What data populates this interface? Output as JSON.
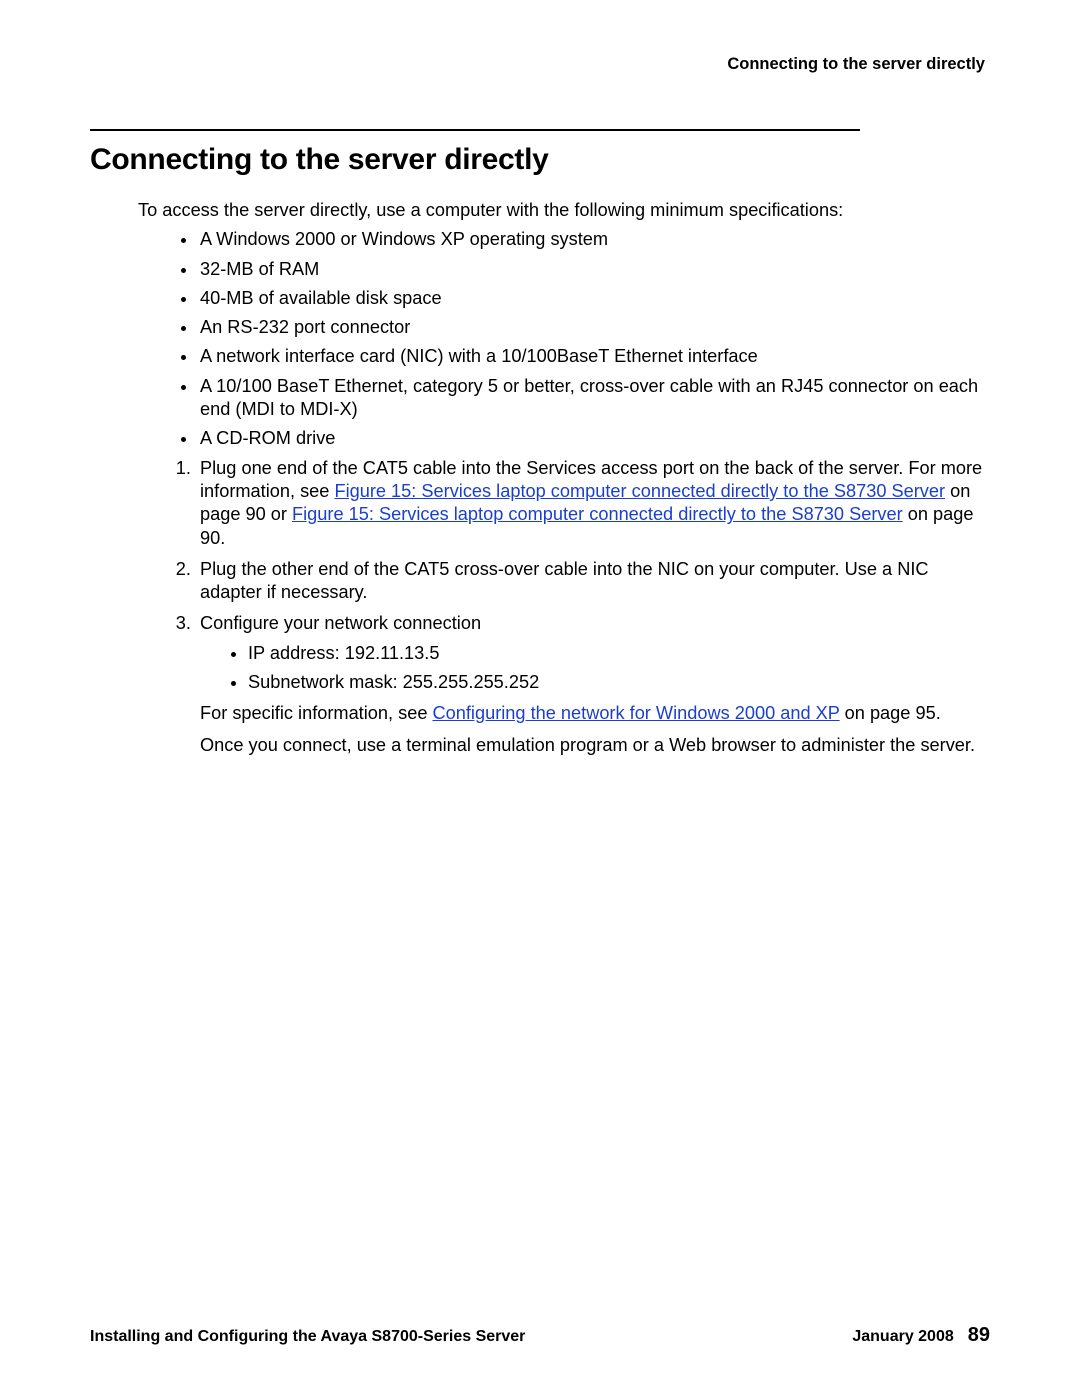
{
  "header": {
    "running_title": "Connecting to the server directly"
  },
  "title": "Connecting to the server directly",
  "intro": "To access the server directly, use a computer with the following minimum specifications:",
  "specs": [
    "A Windows 2000 or Windows XP operating system",
    "32-MB of RAM",
    "40-MB of available disk space",
    "An RS-232 port connector",
    "A network interface card (NIC) with a 10/100BaseT Ethernet interface",
    "A 10/100 BaseT Ethernet, category 5 or better, cross-over cable with an RJ45 connector on each end (MDI to MDI-X)",
    "A CD-ROM drive"
  ],
  "steps": {
    "s1": {
      "before_link1": "Plug one end of the CAT5 cable into the Services access port on the back of the server. For more information, see ",
      "link1": "Figure 15:  Services laptop computer connected directly to the S8730 Server",
      "between": " on page 90 or ",
      "link2": "Figure 15:  Services laptop computer connected directly to the S8730 Server",
      "after_link2": " on page 90."
    },
    "s2": "Plug the other end of the CAT5 cross-over cable into the NIC on your computer. Use a NIC adapter if necessary.",
    "s3": {
      "lead": "Configure your network connection",
      "items": [
        "IP address: 192.11.13.5",
        "Subnetwork mask: 255.255.255.252"
      ],
      "see_before": "For specific information, see ",
      "see_link": "Configuring the network for Windows 2000 and XP",
      "see_after": " on page 95.",
      "final": "Once you connect, use a terminal emulation program or a Web browser to administer the server."
    }
  },
  "footer": {
    "doc_title": "Installing and Configuring the Avaya S8700-Series Server",
    "date": "January 2008",
    "page_number": "89"
  }
}
